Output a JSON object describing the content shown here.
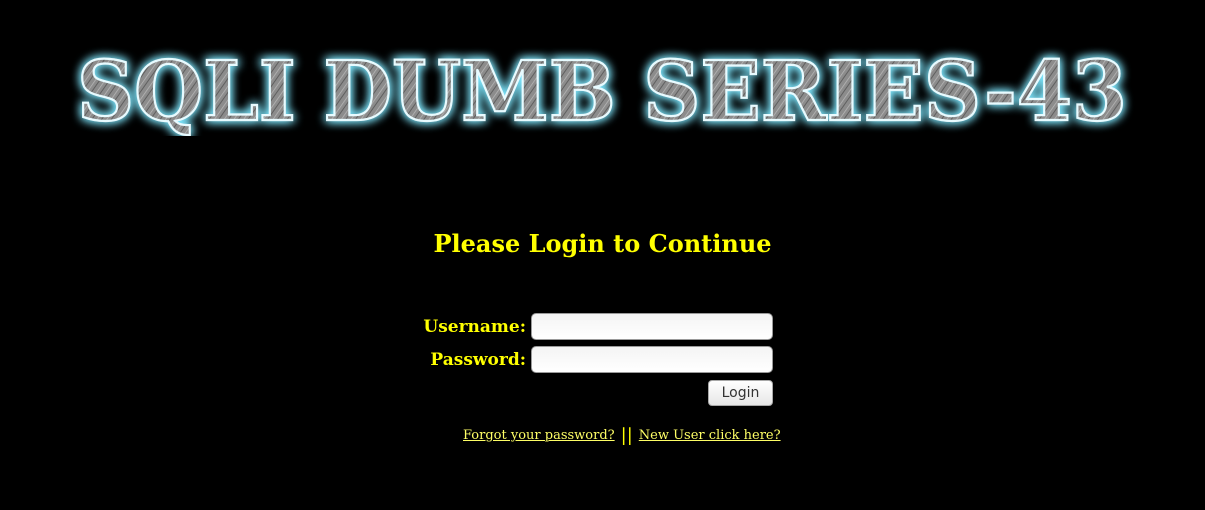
{
  "banner": {
    "text": "SQLI DUMB SERIES-43"
  },
  "login": {
    "heading": "Please Login to Continue",
    "username_label": "Username:",
    "username_value": "",
    "password_label": "Password:",
    "password_value": "",
    "submit_label": "Login"
  },
  "links": {
    "forgot": "Forgot your password?",
    "separator": "||",
    "new_user": "New User click here?"
  },
  "colors": {
    "background": "#000000",
    "text": "#ffff00",
    "banner_glow": "#7fe8ff",
    "banner_fill": "#8a8a8a"
  }
}
